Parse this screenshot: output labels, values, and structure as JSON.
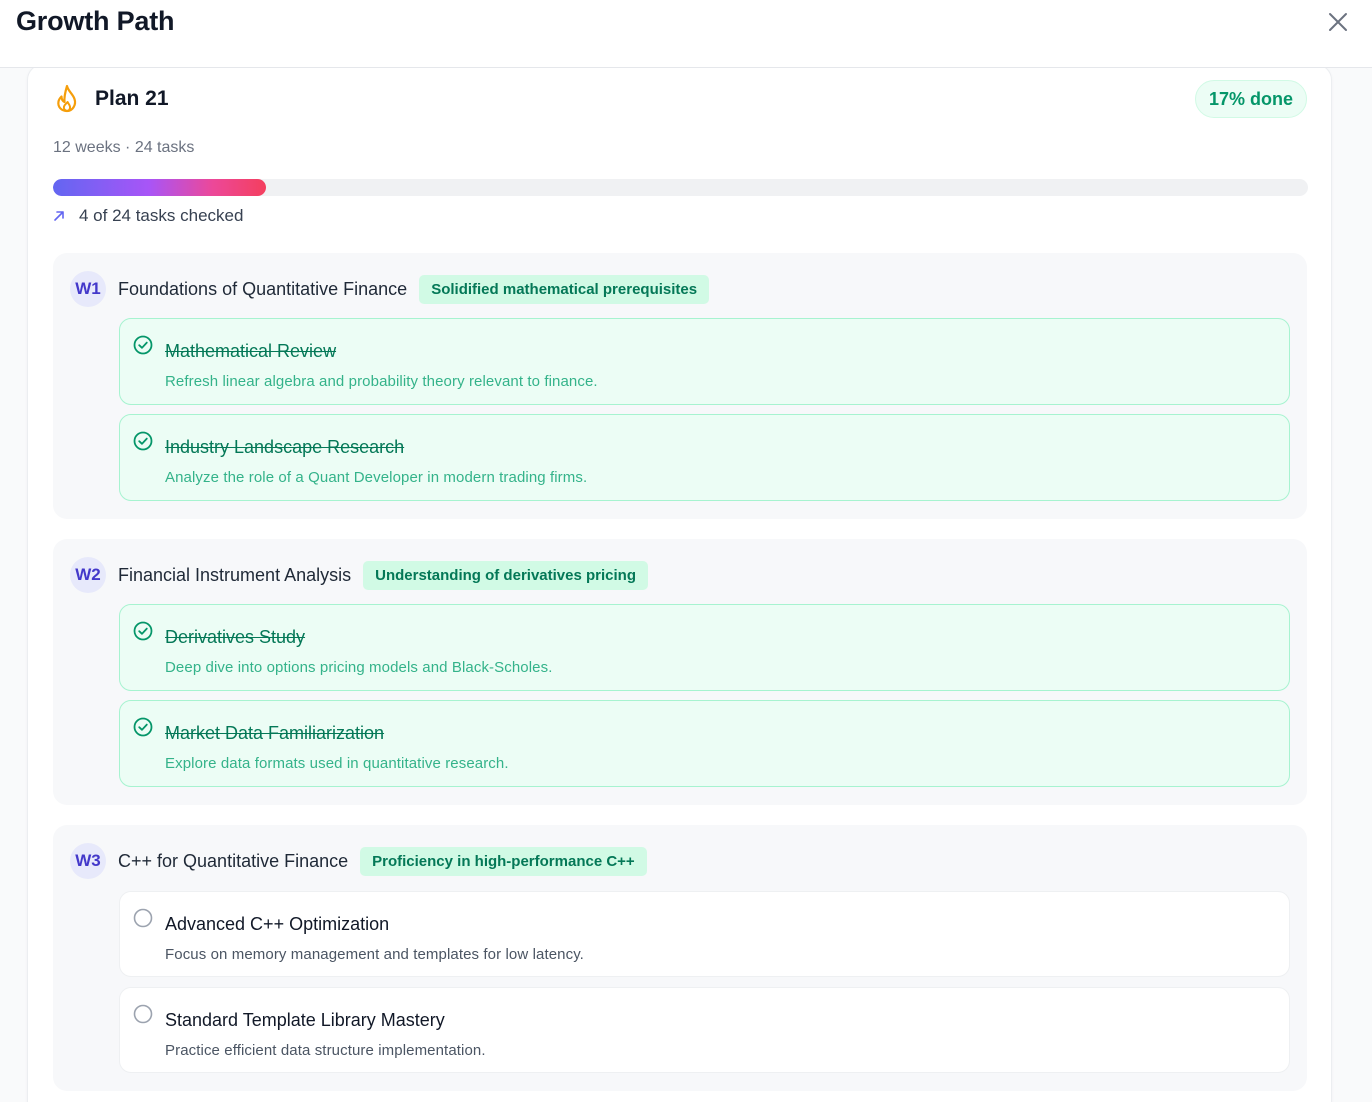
{
  "header": {
    "title": "Growth Path"
  },
  "plan": {
    "title": "Plan 21",
    "done_label": "17% done",
    "meta": "12 weeks · 24 tasks",
    "progress_fraction": 0.17,
    "checked_label": "4 of 24 tasks checked"
  },
  "colors": {
    "done_green": "#059669",
    "task_done_bg": "#ecfdf5",
    "week_badge": "#4338ca",
    "progress_gradient": [
      "#6366f1",
      "#a855f7",
      "#ec4899",
      "#f43f5e"
    ]
  },
  "icons": {
    "close": "close-icon",
    "flame": "flame-icon",
    "trend": "arrow-up-right-icon",
    "done": "check-circle-icon",
    "open": "empty-circle-icon"
  },
  "weeks": [
    {
      "badge": "W1",
      "title": "Foundations of Quantitative Finance",
      "goal": "Solidified mathematical prerequisites",
      "tasks": [
        {
          "title": "Mathematical Review",
          "desc": "Refresh linear algebra and probability theory relevant to finance.",
          "done": true
        },
        {
          "title": "Industry Landscape Research",
          "desc": "Analyze the role of a Quant Developer in modern trading firms.",
          "done": true
        }
      ]
    },
    {
      "badge": "W2",
      "title": "Financial Instrument Analysis",
      "goal": "Understanding of derivatives pricing",
      "tasks": [
        {
          "title": "Derivatives Study",
          "desc": "Deep dive into options pricing models and Black-Scholes.",
          "done": true
        },
        {
          "title": "Market Data Familiarization",
          "desc": "Explore data formats used in quantitative research.",
          "done": true
        }
      ]
    },
    {
      "badge": "W3",
      "title": "C++ for Quantitative Finance",
      "goal": "Proficiency in high-performance C++",
      "tasks": [
        {
          "title": "Advanced C++ Optimization",
          "desc": "Focus on memory management and templates for low latency.",
          "done": false
        },
        {
          "title": "Standard Template Library Mastery",
          "desc": "Practice efficient data structure implementation.",
          "done": false
        }
      ]
    }
  ]
}
